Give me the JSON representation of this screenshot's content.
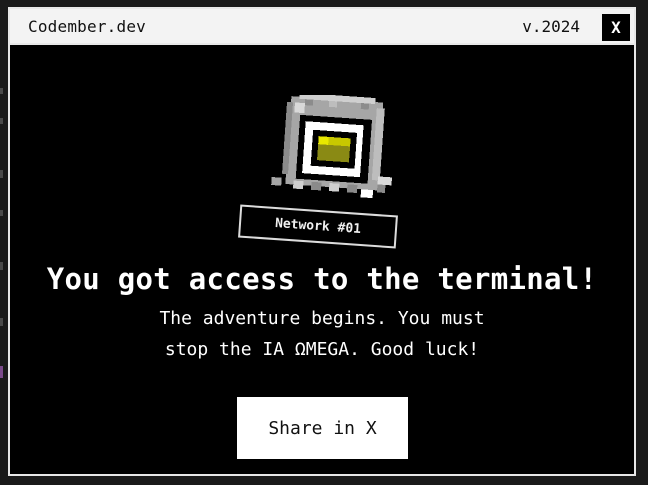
{
  "window": {
    "title": "Codember.dev",
    "version": "v.2024",
    "close_label": "X"
  },
  "badge": {
    "label": "Network #01"
  },
  "main": {
    "headline": "You got access to the terminal!",
    "subtext_lines": [
      "The adventure begins. You must",
      "stop the IA ΩMEGA. Good luck!"
    ]
  },
  "actions": {
    "share_label": "Share in X"
  },
  "colors": {
    "background": "#000000",
    "titlebar": "#f3f3f3",
    "text": "#ffffff",
    "robot_screen": "#c8c800",
    "robot_body": "#a6a6a6"
  },
  "icons": {
    "mascot": "pixel-robot-icon"
  }
}
